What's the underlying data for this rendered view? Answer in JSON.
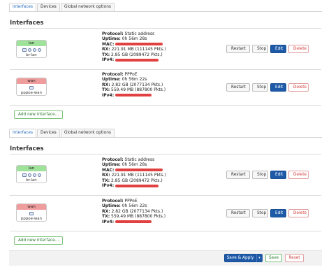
{
  "tabs": [
    "Interfaces",
    "Devices",
    "Global network options"
  ],
  "section_title": "Interfaces",
  "interfaces": [
    {
      "name": "lan",
      "device": "br-lan",
      "color": "#9fe29a",
      "protocol": "Static address",
      "uptime": "0h 56m 28s",
      "rx": "221.91 MB (111145 Pkts.)",
      "tx": "2.85 GB (2089472 Pkts.)",
      "has_mac": true
    },
    {
      "name": "wan",
      "device": "pppoe-wan",
      "color": "#ef9c9c",
      "protocol": "PPPoE",
      "uptime": "0h 56m 22s",
      "rx": "2.82 GB (2077134 Pkts.)",
      "tx": "559.49 MB (887800 Pkts.)",
      "has_mac": false
    }
  ],
  "labels": {
    "protocol": "Protocol:",
    "uptime": "Uptime:",
    "mac": "MAC:",
    "rx": "RX:",
    "tx": "TX:",
    "ipv4": "IPv4:"
  },
  "buttons": {
    "restart": "Restart",
    "stop": "Stop",
    "edit": "Edit",
    "delete": "Delete",
    "add": "Add new interface...",
    "save_apply": "Save & Apply",
    "save": "Save",
    "reset": "Reset",
    "dropdown": "▾"
  },
  "colors": {
    "accent": "#1e5aa8",
    "lan": "#9fe29a",
    "wan": "#ef9c9c",
    "redaction": "#e24141"
  }
}
